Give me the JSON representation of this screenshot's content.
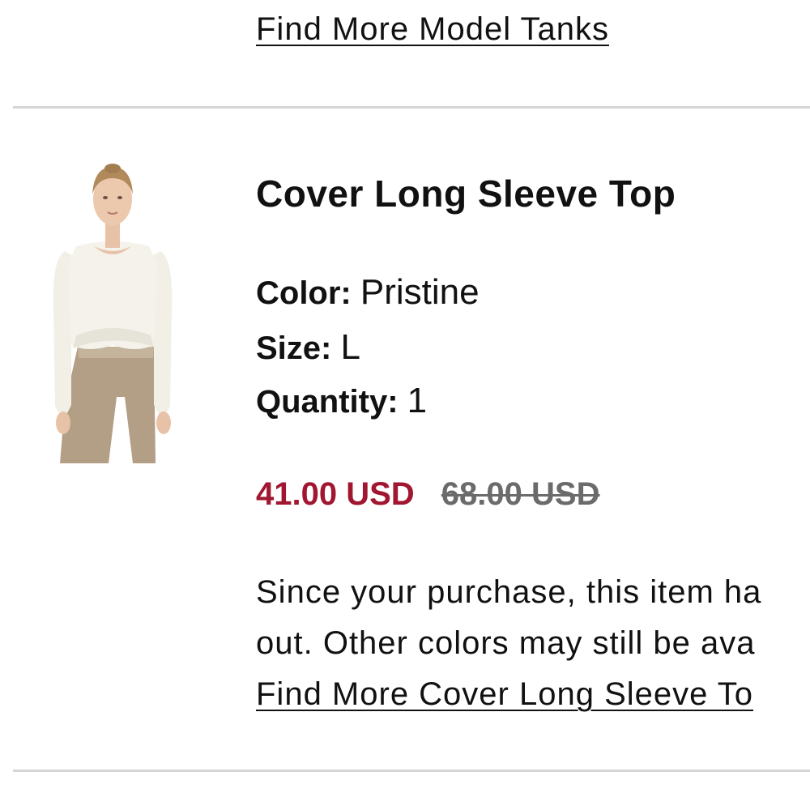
{
  "previous_item": {
    "find_more_link": "Find More Model Tanks"
  },
  "item": {
    "title": "Cover Long Sleeve Top",
    "image_icon": "product-photo-model-white-long-sleeve-top",
    "color_label": "Color:",
    "color_value": "Pristine",
    "size_label": "Size:",
    "size_value": "L",
    "quantity_label": "Quantity:",
    "quantity_value": "1",
    "sale_price": "41.00 USD",
    "original_price": "68.00 USD",
    "notice_line1": "Since your purchase, this item ha",
    "notice_line2": "out. Other colors may still be ava",
    "find_more_link": "Find More Cover Long Sleeve To"
  },
  "colors": {
    "sale_price": "#a11630",
    "original_price": "#6b6b6b",
    "divider": "#d6d6d6"
  }
}
